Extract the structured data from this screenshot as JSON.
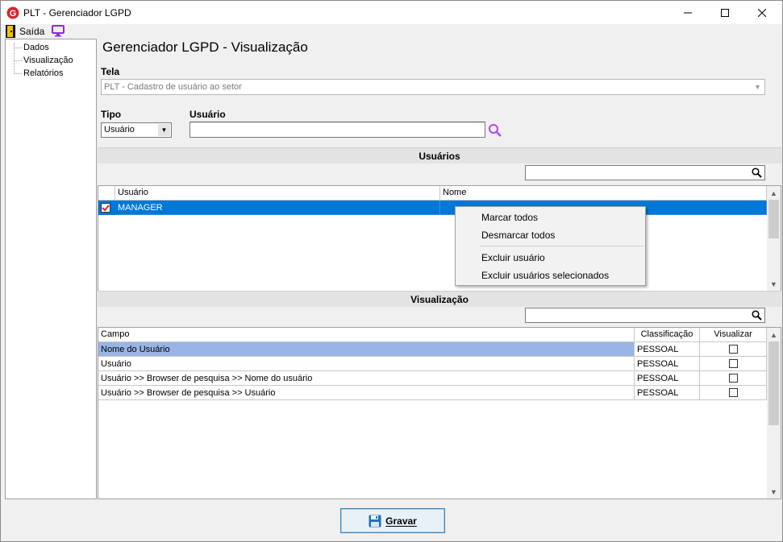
{
  "window": {
    "title": "PLT - Gerenciador LGPD",
    "minimize_glyph": "—",
    "maximize_glyph": "☐",
    "close_glyph": "✕"
  },
  "menu": {
    "exit_label": "Saída"
  },
  "tree": {
    "items": [
      "Dados",
      "Visualização",
      "Relatórios"
    ]
  },
  "page": {
    "title": "Gerenciador LGPD - Visualização"
  },
  "form": {
    "tela_label": "Tela",
    "tela_value": "PLT - Cadastro de usuário ao setor",
    "tipo_label": "Tipo",
    "tipo_value": "Usuário",
    "usuario_label": "Usuário",
    "usuario_value": ""
  },
  "users_section": {
    "header": "Usuários",
    "filter_value": "",
    "columns": [
      "Usuário",
      "Nome"
    ],
    "rows": [
      {
        "checked": true,
        "usuario": "MANAGER",
        "nome": ""
      }
    ]
  },
  "context_menu": {
    "items": [
      "Marcar todos",
      "Desmarcar todos",
      "Excluir usuário",
      "Excluir usuários selecionados"
    ]
  },
  "view_section": {
    "header": "Visualização",
    "filter_value": "",
    "columns": [
      "Campo",
      "Classificação",
      "Visualizar"
    ],
    "rows": [
      {
        "campo": "Nome do Usuário",
        "classificacao": "PESSOAL",
        "visualizar": false
      },
      {
        "campo": "Usuário",
        "classificacao": "PESSOAL",
        "visualizar": false
      },
      {
        "campo": "Usuário >> Browser de pesquisa >> Nome do usuário",
        "classificacao": "PESSOAL",
        "visualizar": false
      },
      {
        "campo": "Usuário >> Browser de pesquisa >> Usuário",
        "classificacao": "PESSOAL",
        "visualizar": false
      }
    ]
  },
  "footer": {
    "save_label": "Gravar"
  },
  "colors": {
    "selection_blue": "#0078d7",
    "row_highlight": "#99b4e6",
    "accent_purple": "#8a2be2",
    "logo_red": "#d9242b"
  },
  "icons": [
    "app-logo-icon",
    "exit-door-icon",
    "monitor-icon",
    "search-icon",
    "scroll-up-icon",
    "scroll-down-icon",
    "save-disk-icon"
  ]
}
